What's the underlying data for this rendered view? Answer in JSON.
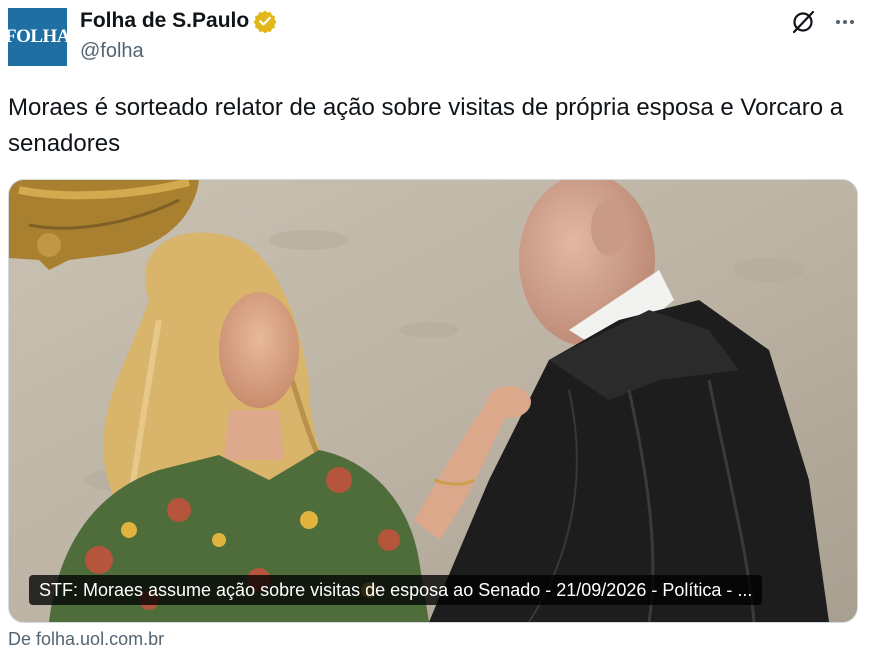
{
  "author": {
    "avatar_text": "FOLHA",
    "display_name": "Folha de S.Paulo",
    "handle": "@folha",
    "verified_badge": "gold-verified-badge",
    "brand_color": "#1f6fa3",
    "badge_color": "#e2b719"
  },
  "toolbar": {
    "grok_icon": "grok-icon",
    "more_icon": "more-icon"
  },
  "tweet": {
    "text": "Moraes é sorteado relator de ação sobre visitas de própria esposa e Vorcaro a senadores"
  },
  "card": {
    "caption": "STF: Moraes assume ação sobre visitas de esposa ao Senado - 21/09/2026 - Política - ...",
    "source": "De folha.uol.com.br"
  }
}
